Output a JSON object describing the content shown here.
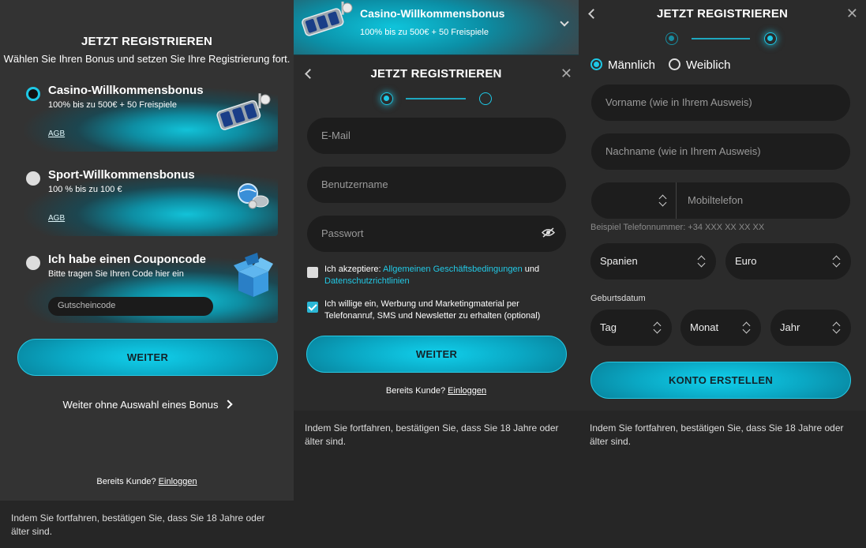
{
  "panel1": {
    "title": "JETZT REGISTRIEREN",
    "subtitle": "Wählen Sie Ihren Bonus und setzen Sie Ihre Registrierung fort.",
    "bonuses": [
      {
        "title": "Casino-Willkommensbonus",
        "desc": "100% bis zu 500€ + 50 Freispiele",
        "agb": "AGB",
        "selected": true,
        "icon": "slot-reels-icon"
      },
      {
        "title": "Sport-Willkommensbonus",
        "desc": "100 % bis zu 100 €",
        "agb": "AGB",
        "selected": false,
        "icon": "sport-balls-icon"
      }
    ],
    "coupon": {
      "title": "Ich habe einen Couponcode",
      "desc": "Bitte tragen Sie Ihren Code hier ein",
      "placeholder": "Gutscheincode",
      "icon": "gift-box-icon"
    },
    "next_button": "WEITER",
    "skip_link": "Weiter ohne Auswahl eines Bonus",
    "login_prompt": "Bereits Kunde?",
    "login_link": "Einloggen",
    "footer": "Indem Sie fortfahren, bestätigen Sie, dass Sie 18 Jahre oder älter sind."
  },
  "panel2": {
    "banner": {
      "title": "Casino-Willkommensbonus",
      "desc": "100% bis zu 500€ + 50 Freispiele"
    },
    "title": "JETZT REGISTRIEREN",
    "fields": {
      "email": "E-Mail",
      "username": "Benutzername",
      "password": "Passwort"
    },
    "terms": {
      "prefix": "Ich akzeptiere: ",
      "agb_link": "Allgemeinen Geschäftsbedingungen",
      "and": " und",
      "privacy_link": "Datenschutzrichtlinien",
      "checked": false
    },
    "marketing": {
      "text": "Ich willige ein, Werbung und Marketingmaterial per Telefonanruf, SMS und Newsletter zu erhalten (optional)",
      "checked": true
    },
    "next_button": "WEITER",
    "login_prompt": "Bereits Kunde?",
    "login_link": "Einloggen",
    "footer": "Indem Sie fortfahren, bestätigen Sie, dass Sie 18 Jahre oder älter sind."
  },
  "panel3": {
    "title": "JETZT REGISTRIEREN",
    "gender": {
      "male": "Männlich",
      "female": "Weiblich",
      "selected": "male"
    },
    "fields": {
      "firstname": "Vorname (wie in Ihrem Ausweis)",
      "lastname": "Nachname (wie in Ihrem Ausweis)",
      "phone": "Mobiltelefon"
    },
    "phone_hint": "Beispiel Telefonnummer: +34 XXX XX XX XX",
    "country": "Spanien",
    "currency": "Euro",
    "birth_label": "Geburtsdatum",
    "birth": {
      "day": "Tag",
      "month": "Monat",
      "year": "Jahr"
    },
    "create_button": "KONTO ERSTELLEN",
    "footer": "Indem Sie fortfahren, bestätigen Sie, dass Sie 18 Jahre oder älter sind."
  },
  "colors": {
    "accent": "#1ec8e6",
    "panel_bg": "#333333",
    "field_bg": "#1d1d1d",
    "footer_bg": "#262626"
  }
}
